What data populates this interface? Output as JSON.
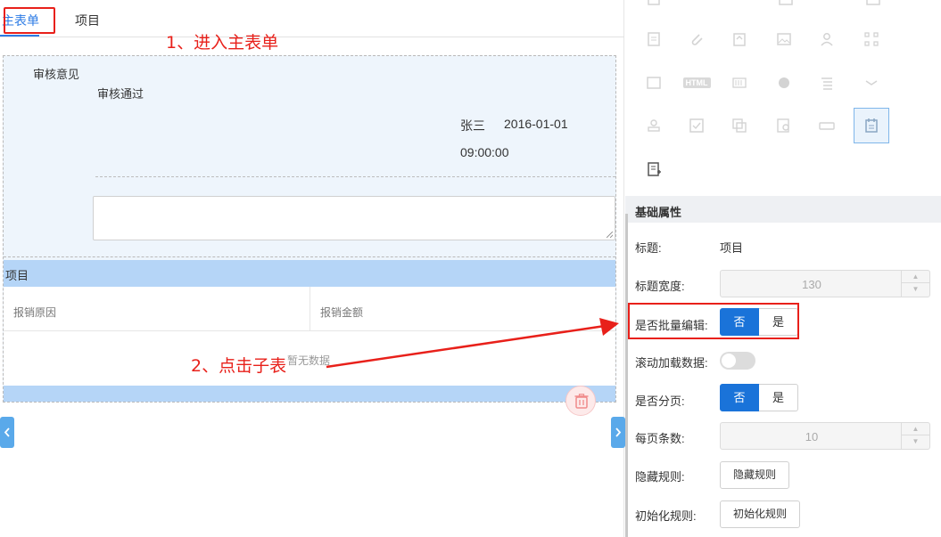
{
  "tabs": {
    "main": "主表单",
    "item": "项目"
  },
  "review": {
    "label": "审核意见",
    "value": "审核通过",
    "user": "张三",
    "date": "2016-01-01",
    "time": "09:00:00"
  },
  "subtable": {
    "title": "项目",
    "columns": [
      "报销原因",
      "报销金额"
    ],
    "empty_text": "暂无数据"
  },
  "annotations": {
    "step1": "1、进入主表单",
    "step2": "2、点击子表"
  },
  "toolbox": {
    "html_icon_label": "HTML"
  },
  "props": {
    "section_title": "基础属性",
    "title_label": "标题:",
    "title_value": "项目",
    "title_width_label": "标题宽度:",
    "title_width_value": "130",
    "batch_edit_label": "是否批量编辑:",
    "batch_edit_no": "否",
    "batch_edit_yes": "是",
    "scroll_load_label": "滚动加载数据:",
    "paging_label": "是否分页:",
    "paging_no": "否",
    "paging_yes": "是",
    "page_size_label": "每页条数:",
    "page_size_value": "10",
    "hide_rule_label": "隐藏规则:",
    "hide_rule_button": "隐藏规则",
    "init_rule_label": "初始化规则:",
    "init_rule_button": "初始化规则"
  },
  "colors": {
    "accent": "#1a73d9",
    "annotation": "#e8201a",
    "subtable_header": "#b5d5f7"
  }
}
